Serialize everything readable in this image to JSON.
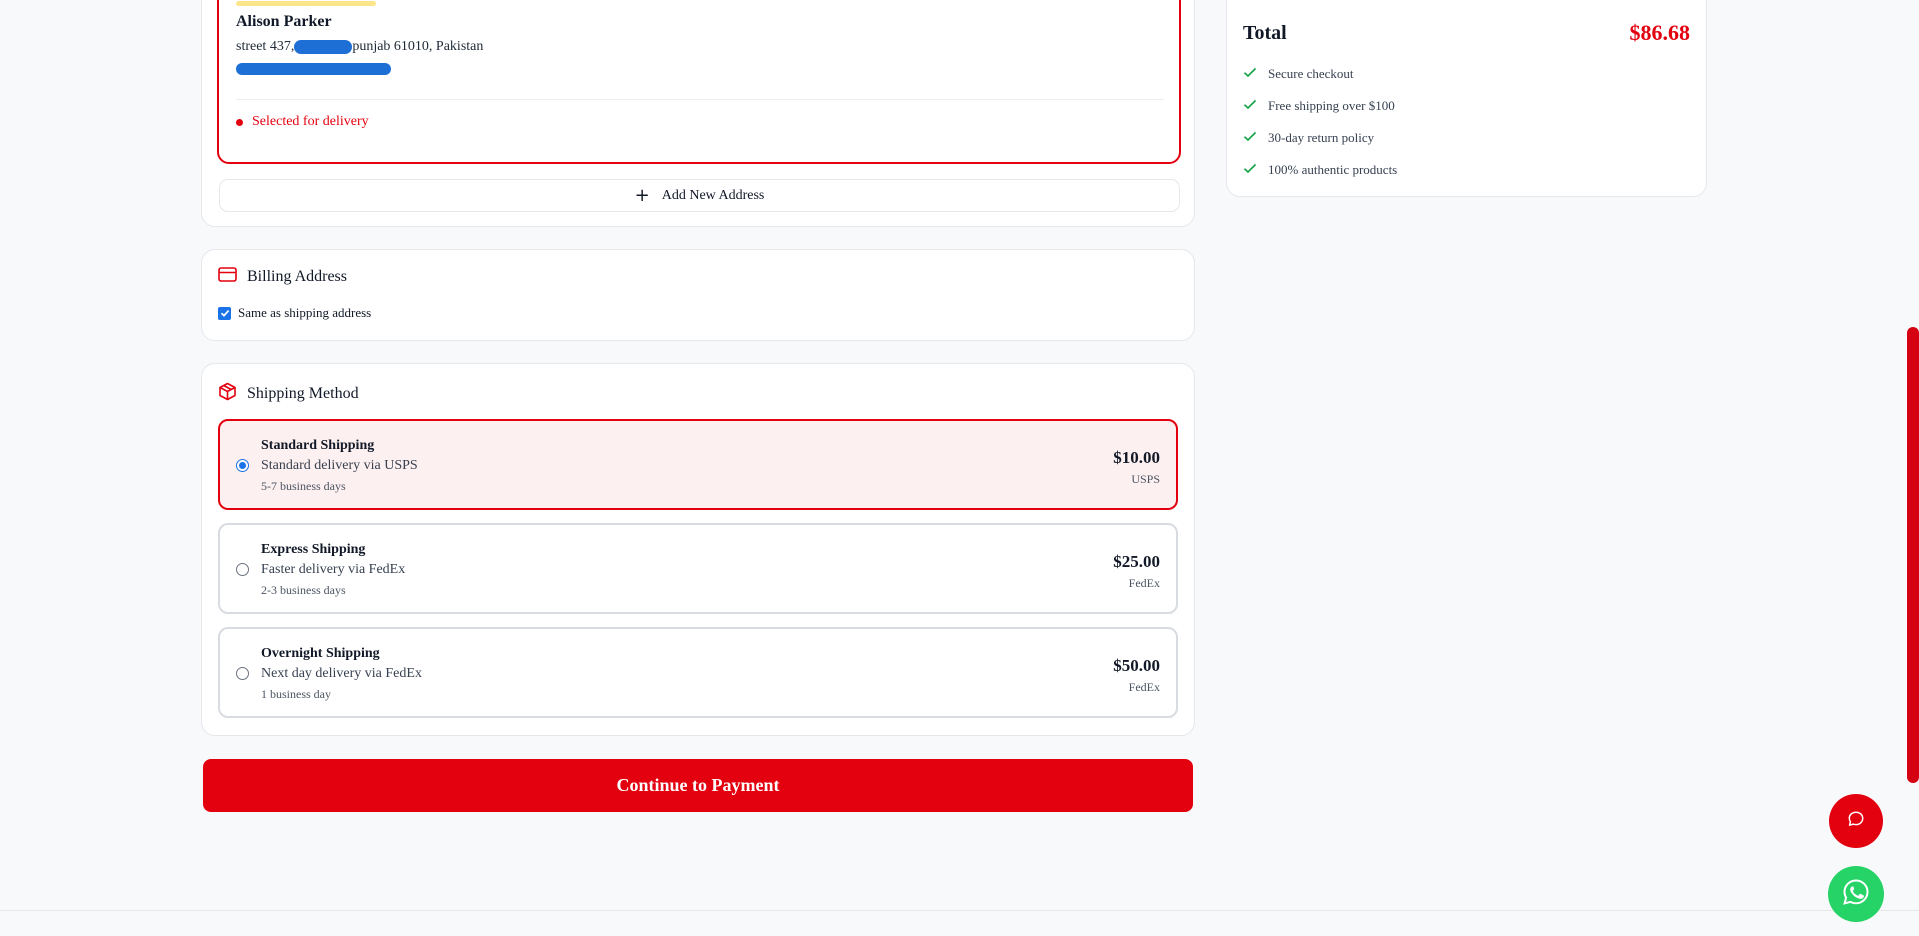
{
  "shipping_address": {
    "name": "Alison Parker",
    "street_prefix": "street 437, ",
    "street_suffix": "punjab 61010, Pakistan",
    "status": "Selected for delivery",
    "add_new_label": "Add New Address"
  },
  "billing": {
    "title": "Billing Address",
    "same_as_shipping_label": "Same as shipping address",
    "same_as_shipping_checked": true
  },
  "shipping_method": {
    "title": "Shipping Method",
    "options": [
      {
        "title": "Standard Shipping",
        "description": "Standard delivery via USPS",
        "days": "5-7 business days",
        "price": "$10.00",
        "carrier": "USPS",
        "selected": true
      },
      {
        "title": "Express Shipping",
        "description": "Faster delivery via FedEx",
        "days": "2-3 business days",
        "price": "$25.00",
        "carrier": "FedEx",
        "selected": false
      },
      {
        "title": "Overnight Shipping",
        "description": "Next day delivery via FedEx",
        "days": "1 business day",
        "price": "$50.00",
        "carrier": "FedEx",
        "selected": false
      }
    ]
  },
  "continue_label": "Continue to Payment",
  "summary": {
    "total_label": "Total",
    "total_value": "$86.68",
    "features": [
      "Secure checkout",
      "Free shipping over $100",
      "30-day return policy",
      "100% authentic products"
    ]
  },
  "colors": {
    "accent": "#e3000f",
    "check": "#16a34a",
    "whatsapp": "#25d366",
    "radio": "#1a73e8"
  },
  "icons": {
    "billing": "credit-card-icon",
    "shipping": "package-icon",
    "feature": "check-icon",
    "chat": "chat-bubble-icon",
    "whatsapp": "whatsapp-icon"
  }
}
